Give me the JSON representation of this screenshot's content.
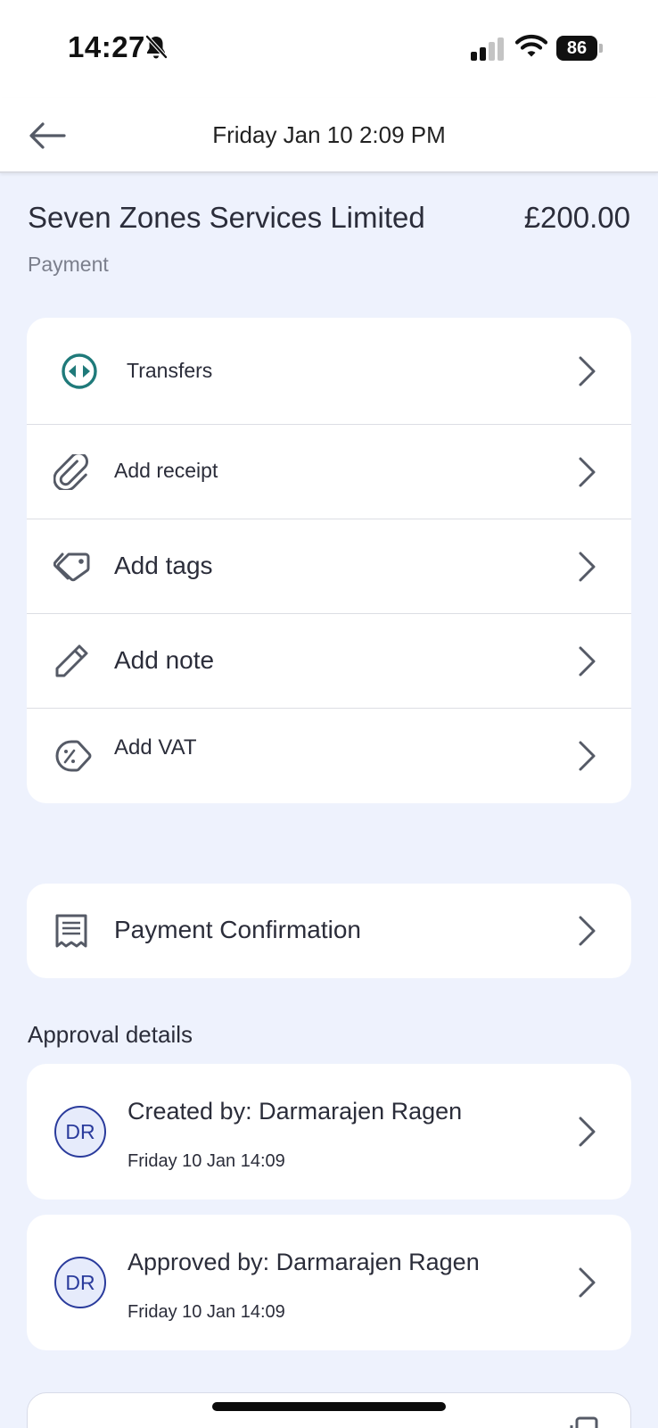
{
  "status_bar": {
    "time": "14:27",
    "battery": "86",
    "icons": [
      "bell-slash-icon",
      "cellular-signal-icon",
      "wifi-icon",
      "battery-icon"
    ]
  },
  "header": {
    "title": "Friday Jan 10 2:09 PM",
    "back_icon": "arrow-left-icon"
  },
  "transaction": {
    "merchant": "Seven Zones Services Limited",
    "amount": "£200.00",
    "type": "Payment"
  },
  "actions": [
    {
      "label": "Transfers",
      "icon": "transfers-icon"
    },
    {
      "label": "Add receipt",
      "icon": "paperclip-icon"
    },
    {
      "label": "Add tags",
      "icon": "tag-icon"
    },
    {
      "label": "Add note",
      "icon": "pencil-icon"
    },
    {
      "label": "Add VAT",
      "icon": "percent-tag-icon"
    }
  ],
  "confirmation": {
    "label": "Payment Confirmation",
    "icon": "receipt-icon"
  },
  "approval": {
    "section_title": "Approval details",
    "entries": [
      {
        "initials": "DR",
        "text": "Created by: Darmarajen Ragen",
        "date": "Friday 10 Jan 14:09"
      },
      {
        "initials": "DR",
        "text": "Approved by: Darmarajen Ragen",
        "date": "Friday 10 Jan 14:09"
      }
    ]
  },
  "colors": {
    "background": "#eef2fd",
    "card": "#ffffff",
    "accent_teal": "#1f7a7a",
    "avatar_blue": "#2a3b9c",
    "text": "#2b2d3a",
    "muted": "#7b7f8c"
  }
}
